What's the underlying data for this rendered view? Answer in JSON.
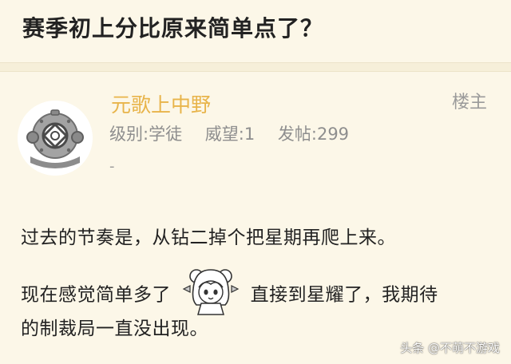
{
  "thread": {
    "title": "赛季初上分比原来简单点了？"
  },
  "post": {
    "author": "元歌上中野",
    "floor_tag": "楼主",
    "level_label": "级别:学徒",
    "prestige_label": "威望:1",
    "posts_label": "发帖:299",
    "signature": "-",
    "paragraphs": {
      "p1": "过去的节奏是，从钻二掉个把星期再爬上来。",
      "p2_before": "现在感觉简单多了",
      "p2_after": "直接到星耀了，我期待",
      "p3": "的制裁局一直没出现。"
    }
  },
  "watermark": "头条 @不萌不游戏",
  "colors": {
    "background": "#fcf7e8",
    "username": "#e8b44a",
    "meta": "#8e8e8e",
    "text": "#222222"
  },
  "icons": {
    "avatar": "diving-helmet-icon",
    "sticker": "anime-girl-sticker"
  }
}
